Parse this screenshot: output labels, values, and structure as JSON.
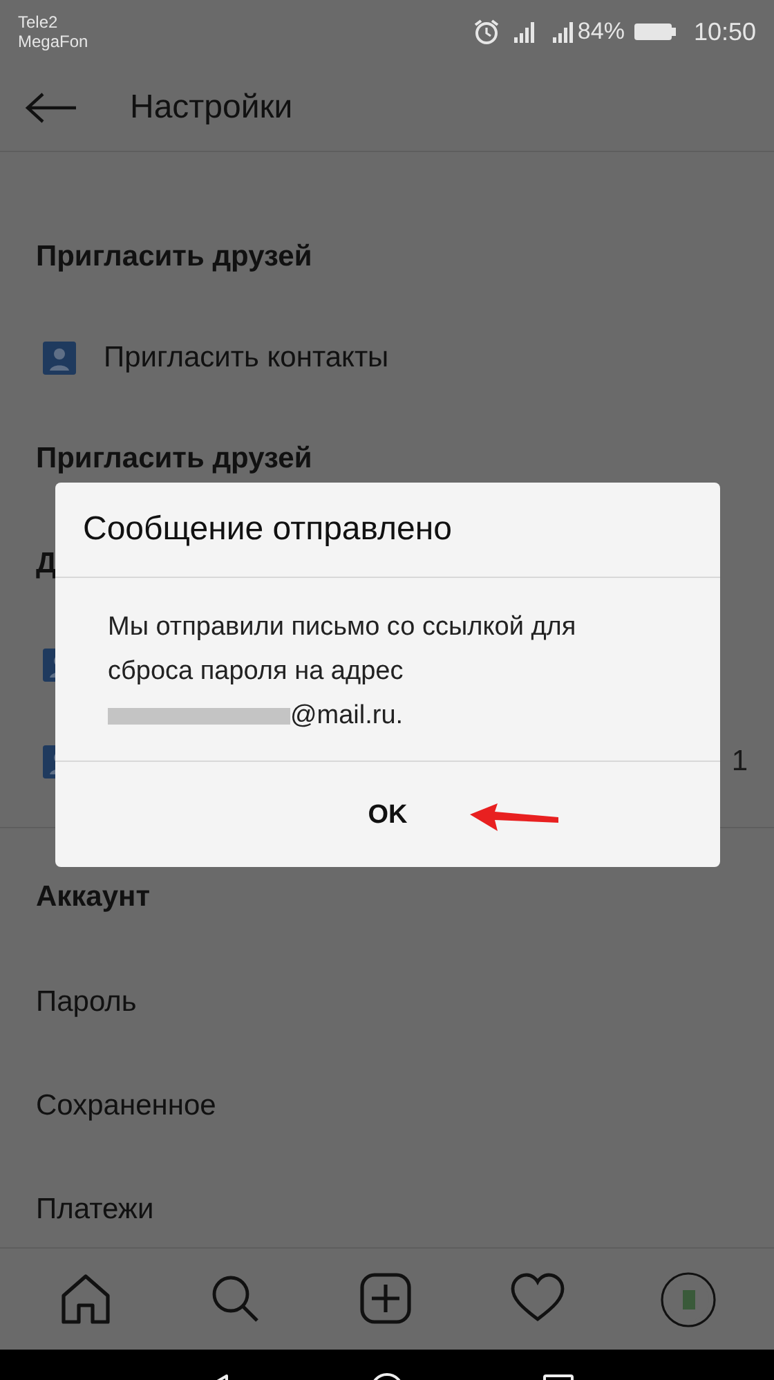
{
  "status_bar": {
    "carriers": [
      "Tele2",
      "MegaFon"
    ],
    "battery": "84%",
    "time": "10:50"
  },
  "header": {
    "title": "Настройки"
  },
  "rows": [
    {
      "kind": "section",
      "text": "Пригласить друзей"
    },
    {
      "kind": "icon",
      "text": "Пригласить контакты"
    },
    {
      "kind": "section",
      "text": "Пригласить друзей"
    },
    {
      "kind": "section",
      "text": "Д"
    },
    {
      "kind": "icon"
    },
    {
      "kind": "icon",
      "trailing": "1"
    },
    {
      "kind": "divider"
    },
    {
      "kind": "section",
      "text": "Аккаунт"
    },
    {
      "kind": "item",
      "text": "Пароль"
    },
    {
      "kind": "item",
      "text": "Сохраненное"
    },
    {
      "kind": "item",
      "text": "Платежи"
    }
  ],
  "dialog": {
    "title": "Сообщение отправлено",
    "message": "Мы отправили письмо со ссылкой для сброса пароля на адрес",
    "email": "@mail.ru.",
    "button": "OK"
  }
}
